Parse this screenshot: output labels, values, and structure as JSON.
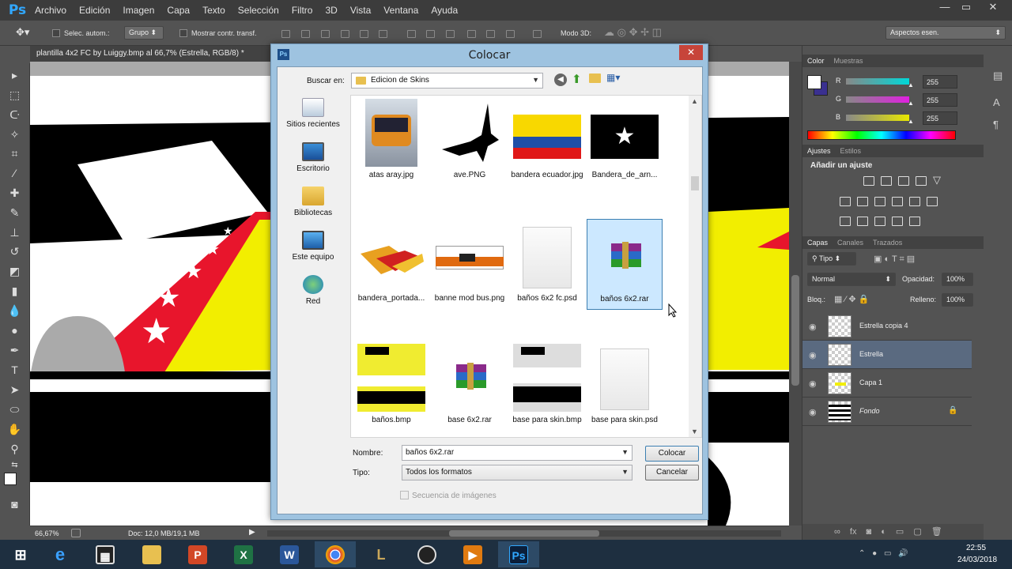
{
  "app": {
    "logo": "Ps",
    "menu": [
      "Archivo",
      "Edición",
      "Imagen",
      "Capa",
      "Texto",
      "Selección",
      "Filtro",
      "3D",
      "Vista",
      "Ventana",
      "Ayuda"
    ],
    "window_controls": [
      "—",
      "▭",
      "✕"
    ]
  },
  "options_bar": {
    "auto_select_label": "Selec. autom.:",
    "auto_select_value": "Grupo",
    "show_transform_label": "Mostrar contr. transf.",
    "mode3d_label": "Modo 3D:",
    "workspace": "Aspectos esen."
  },
  "document": {
    "tab_title": "plantilla 4x2 FC by Luiggy.bmp al 66,7% (Estrella, RGB/8) *",
    "zoom": "66,67%",
    "doc_info": "Doc: 12,0 MB/19,1 MB"
  },
  "dialog": {
    "title": "Colocar",
    "look_in_label": "Buscar en:",
    "look_in_value": "Edicion de Skins",
    "places": [
      "Sitios recientes",
      "Escritorio",
      "Bibliotecas",
      "Este equipo",
      "Red"
    ],
    "files": [
      {
        "name": "atas aray.jpg",
        "kind": "bus"
      },
      {
        "name": "ave.PNG",
        "kind": "bird"
      },
      {
        "name": "bandera ecuador.jpg",
        "kind": "flag-ec"
      },
      {
        "name": "Bandera_de_arn...",
        "kind": "flag-star"
      },
      {
        "name": "bandera_portada...",
        "kind": "banner"
      },
      {
        "name": "banne mod bus.png",
        "kind": "bus-side"
      },
      {
        "name": "baños 6x2 fc.psd",
        "kind": "blank"
      },
      {
        "name": "baños 6x2.rar",
        "kind": "rar",
        "selected": true
      },
      {
        "name": "baños.bmp",
        "kind": "skin"
      },
      {
        "name": "base 6x2.rar",
        "kind": "rar"
      },
      {
        "name": "base para skin.bmp",
        "kind": "skin-bw"
      },
      {
        "name": "base para skin.psd",
        "kind": "blank"
      }
    ],
    "name_label": "Nombre:",
    "name_value": "baños 6x2.rar",
    "type_label": "Tipo:",
    "type_value": "Todos los formatos",
    "sequence_label": "Secuencia de imágenes",
    "place_button": "Colocar",
    "cancel_button": "Cancelar"
  },
  "panels": {
    "color_tabs": [
      "Color",
      "Muestras"
    ],
    "rgb": [
      {
        "ch": "R",
        "value": "255",
        "color": "#00d8d8"
      },
      {
        "ch": "G",
        "value": "255",
        "color": "#e020e0"
      },
      {
        "ch": "B",
        "value": "255",
        "color": "#e8e800"
      }
    ],
    "adjust_tabs": [
      "Ajustes",
      "Estilos"
    ],
    "add_adjustment": "Añadir un ajuste",
    "layers_tabs": [
      "Capas",
      "Canales",
      "Trazados"
    ],
    "kind_filter": "Tipo",
    "blend_mode": "Normal",
    "opacity_label": "Opacidad:",
    "opacity_value": "100%",
    "lock_label": "Bloq.:",
    "fill_label": "Relleno:",
    "fill_value": "100%",
    "layers": [
      {
        "name": "Estrella copia 4",
        "selected": false
      },
      {
        "name": "Estrella",
        "selected": true
      },
      {
        "name": "Capa 1",
        "selected": false
      },
      {
        "name": "Fondo",
        "selected": false,
        "locked": true
      }
    ]
  },
  "taskbar": {
    "time": "22:55",
    "date": "24/03/2018"
  }
}
